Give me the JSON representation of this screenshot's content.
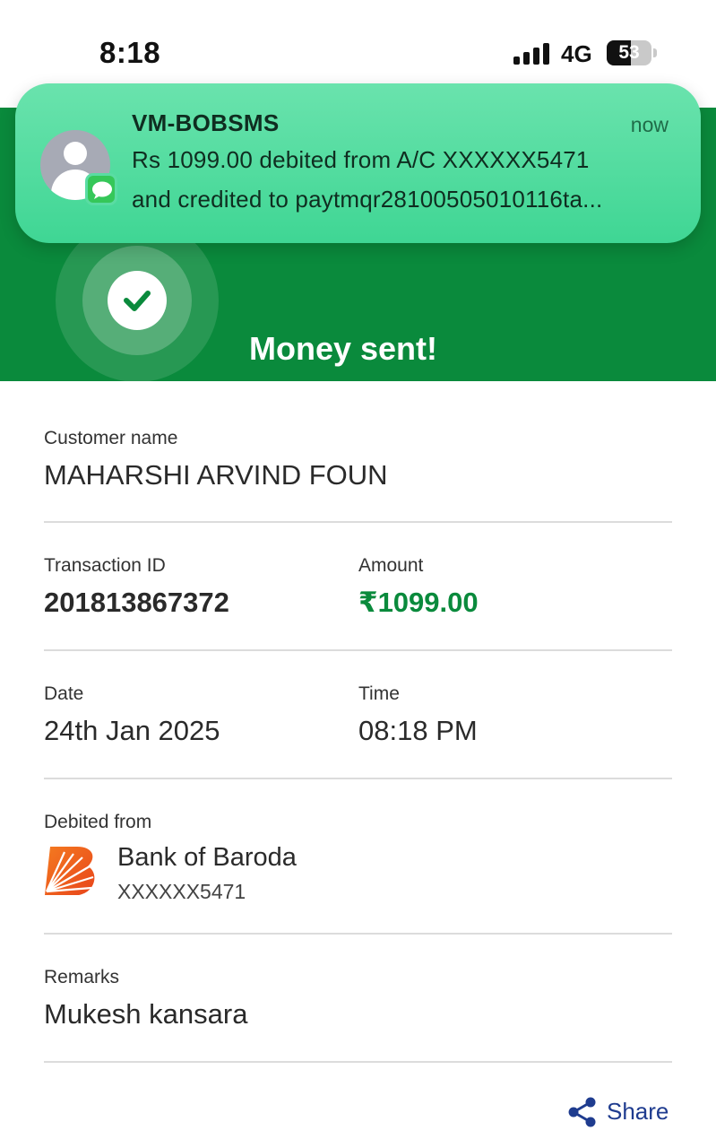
{
  "status_bar": {
    "time": "8:18",
    "network": "4G",
    "battery": "53",
    "battery_level": 0.53
  },
  "header": {
    "title": "Money sent!",
    "color": "#0a8a3c"
  },
  "notification": {
    "sender": "VM-BOBSMS",
    "time": "now",
    "line1": "Rs 1099.00 debited from A/C XXXXXX5471",
    "line2": "and credited to paytmqr28100505010116ta...",
    "app_icon": "messages-icon",
    "avatar_icon": "person-icon"
  },
  "details": {
    "customer_label": "Customer name",
    "customer_value": "MAHARSHI ARVIND FOUN",
    "txn_label": "Transaction ID",
    "txn_value": "201813867372",
    "amount_label": "Amount",
    "amount_value": "₹1099.00",
    "date_label": "Date",
    "date_value": "24th Jan 2025",
    "time_label": "Time",
    "time_value": "08:18 PM",
    "debited_label": "Debited from",
    "bank_name": "Bank of Baroda",
    "bank_account": "XXXXXX5471",
    "bank_logo_icon": "bank-of-baroda-logo-icon",
    "remarks_label": "Remarks",
    "remarks_value": "Mukesh kansara"
  },
  "actions": {
    "share_label": "Share",
    "share_icon": "share-icon",
    "accent": "#1f3c8f"
  }
}
